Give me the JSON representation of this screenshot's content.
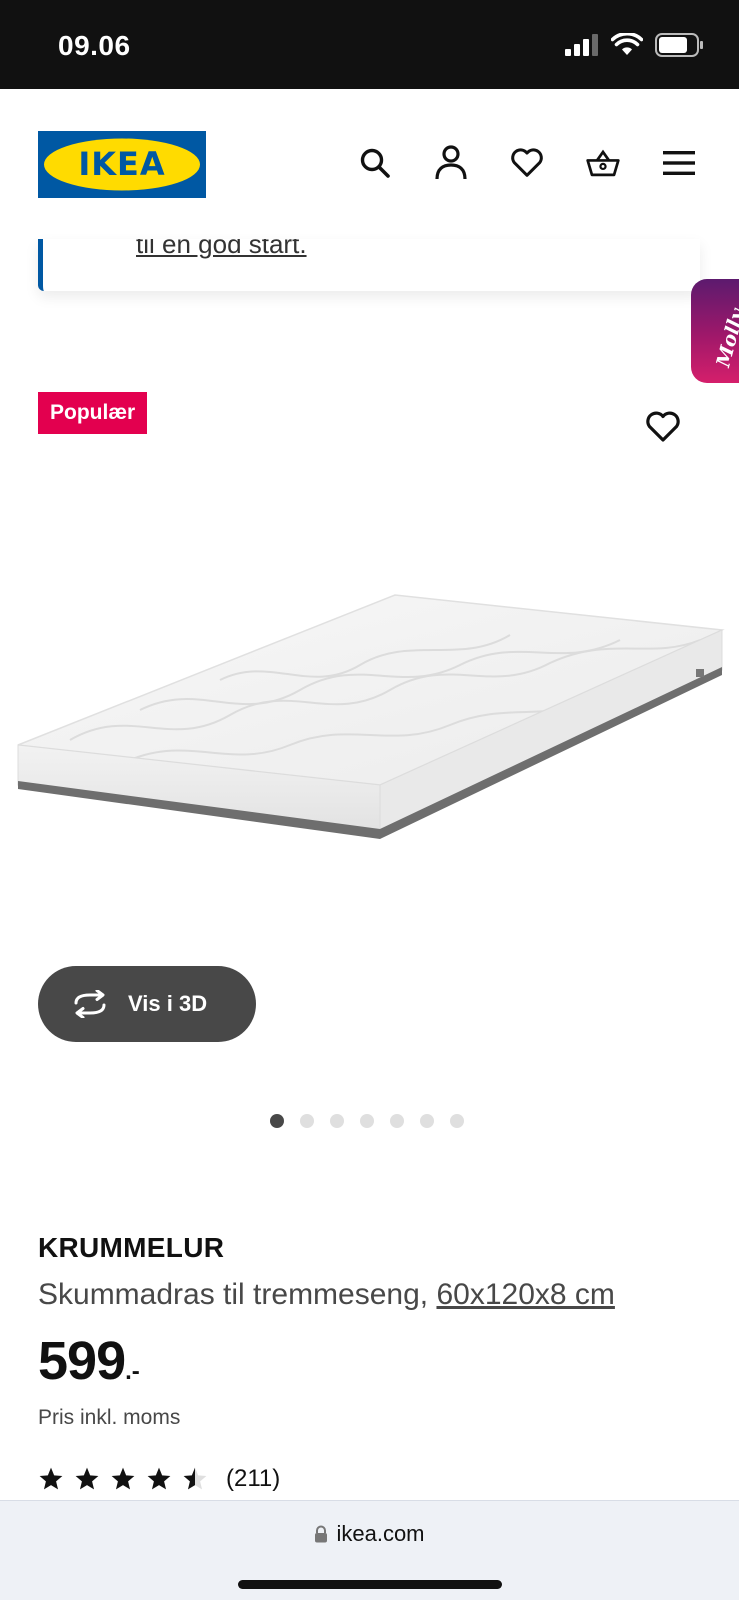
{
  "status_bar": {
    "time": "09.06",
    "icons": [
      "cellular-signal-icon",
      "wifi-icon",
      "battery-icon"
    ]
  },
  "header": {
    "logo_text": "IKEA",
    "brand_colors": {
      "blue": "#0058a3",
      "yellow": "#ffdb00"
    },
    "icons": [
      "search-icon",
      "account-icon",
      "favorites-heart-icon",
      "shopping-basket-icon",
      "hamburger-menu-icon"
    ]
  },
  "notice": {
    "link_text": "til en god start."
  },
  "assistant_tab": {
    "label": "Molly"
  },
  "product": {
    "badge": "Populær",
    "badge_color": "#e3004f",
    "view_3d_label": "Vis i 3D",
    "image_count": 7,
    "active_image_index": 0,
    "name": "KRUMMELUR",
    "description": "Skummadras til tremmeseng,",
    "size": "60x120x8 cm",
    "price_integer": "599",
    "price_suffix": ".-",
    "price_note": "Pris inkl. moms",
    "rating": 4.5,
    "rating_max": 5,
    "review_count": "(211)"
  },
  "browser": {
    "url": "ikea.com"
  }
}
